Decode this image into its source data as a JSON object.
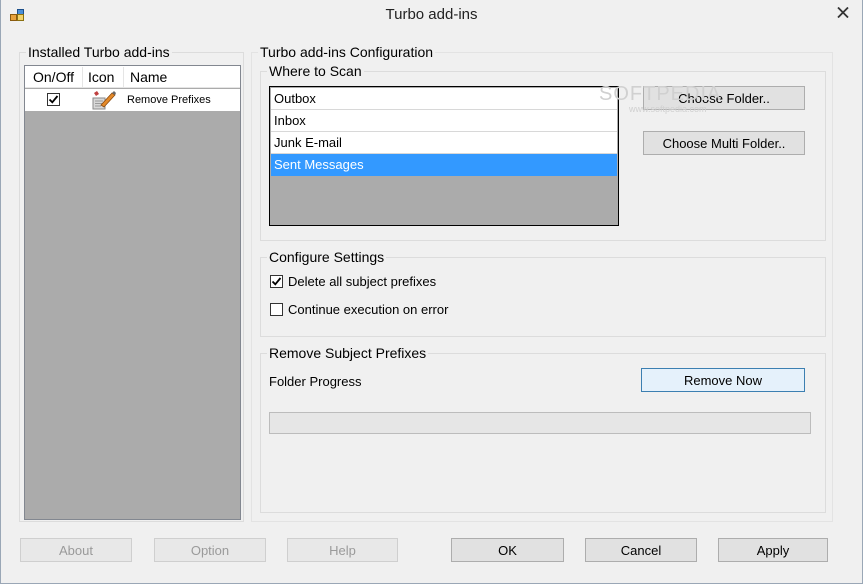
{
  "window": {
    "title": "Turbo add-ins"
  },
  "installed": {
    "title": "Installed Turbo add-ins",
    "columns": {
      "onoff": "On/Off",
      "icon": "Icon",
      "name": "Name"
    },
    "rows": [
      {
        "enabled": true,
        "name": "Remove Prefixes"
      }
    ]
  },
  "config": {
    "title": "Turbo add-ins Configuration",
    "scan": {
      "title": "Where to Scan",
      "folders": [
        "Outbox",
        "Inbox",
        "Junk E-mail",
        "Sent Messages"
      ],
      "selected": "Sent Messages",
      "choose_folder_label": "Choose Folder..",
      "choose_multi_folder_label": "Choose Multi Folder.."
    },
    "settings": {
      "title": "Configure Settings",
      "delete_prefixes_label": "Delete all subject prefixes",
      "delete_prefixes_checked": true,
      "continue_on_error_label": "Continue execution on error",
      "continue_on_error_checked": false
    },
    "remove": {
      "title": "Remove Subject Prefixes",
      "folder_progress_label": "Folder Progress",
      "remove_now_label": "Remove Now",
      "progress": 0
    }
  },
  "watermark": {
    "brand": "SOFTPEDIA",
    "url": "www.softpedia.com"
  },
  "footer": {
    "about_label": "About",
    "option_label": "Option",
    "help_label": "Help",
    "ok_label": "OK",
    "cancel_label": "Cancel",
    "apply_label": "Apply"
  }
}
